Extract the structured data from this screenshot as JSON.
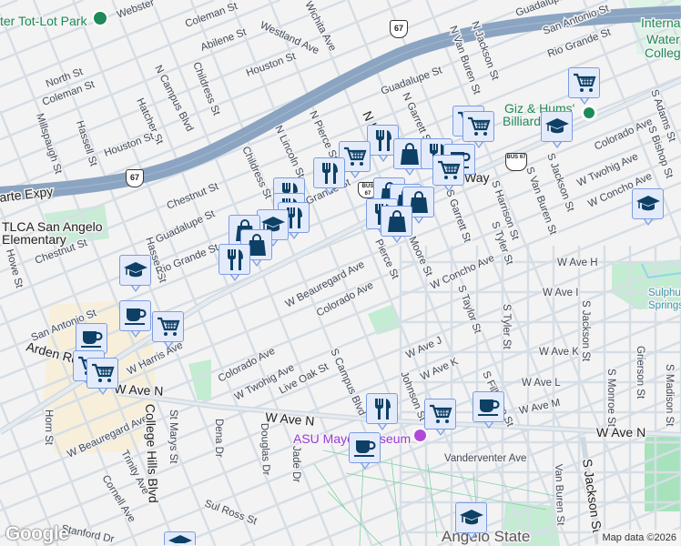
{
  "map": {
    "attribution": "Map data ©2026",
    "logo": "Google",
    "highway_shields": [
      "67",
      "67",
      "BUS 67",
      "BUS 67"
    ],
    "colors": {
      "background": "#f4f3f3",
      "road": "#d6dee6",
      "freeway": "#8ba4c1",
      "park": "#c3ecd2",
      "campus": "#f7efd9",
      "marker_fill": "#e3ebfb",
      "marker_border": "#7b9de0",
      "icon": "#0e4065"
    }
  },
  "pois": [
    {
      "name": "Giz & Hums' Billiards &",
      "icon": "place-pin-icon"
    },
    {
      "name": "ASU Mayer Museum",
      "icon": "museum-icon"
    },
    {
      "name": "ter Tot-Lot Park",
      "icon": "park-tree-icon"
    }
  ],
  "labels": [
    "ter Tot-Lot Park",
    "Webster",
    "Coleman St",
    "Abilene St",
    "Westland Ave",
    "Wichita Ave",
    "Houston St",
    "North St",
    "Coleman St",
    "Millspaugh St",
    "Hassell St",
    "Hatcher St",
    "N Campus Blvd",
    "Childress St",
    "Houston St",
    "arte Expy",
    "Chestnut St",
    "Guadalupe St",
    "N Lincoln St",
    "N Pierce St",
    "Childress St",
    "TLCA San Angelo",
    "Elementary",
    "Howe St",
    "Chestnut St",
    "Hassell St",
    "Rio Grande St",
    "Grande St",
    "San Antonio St",
    "Arden Rd",
    "W Harris Ave",
    "W Ave N",
    "W Beauregard Ave",
    "Horn St",
    "College Hills Blvd",
    "St Marys St",
    "Dena Dr",
    "Douglas Dr",
    "Jade Dr",
    "Trinity Ave",
    "Cornell Ave",
    "Sul Ross St",
    "Stanford Dr",
    "W Beauregard Ave",
    "Colorado Ave",
    "Colorado Ave",
    "W Twohig Ave",
    "Live Oak St",
    "S Campus Blvd",
    "W Ave N",
    "ASU Mayer Museum",
    "Guadalupe St",
    "N Garrett St",
    "N Van Buren St",
    "N Jackson St",
    "Guadalupe St",
    "San Antonio St",
    "Rio Grande St",
    "International",
    "Water",
    "College",
    "Giz & Hums'",
    "Billiards &",
    "Colorado Ave",
    "W Twohig Ave",
    "W Concho Ave",
    "S Adams St",
    "S Bishop St",
    "S Jackson St",
    "S Van Buren St",
    "S Harrison St",
    "S Garrett St",
    "S Tyler St",
    "Pierce St",
    "Moore St",
    "W Ave H",
    "W Concho Ave",
    "W Ave I",
    "S Taylor St",
    "S Tyler St",
    "Sulphur",
    "Springs",
    "W Ave J",
    "W Ave K",
    "W Ave K",
    "W Ave L",
    "S Fillmore St",
    "Johnson St",
    "W Ave M",
    "W Ave N",
    "Vanderventer Ave",
    "S Jackson St",
    "Van Buren St",
    "S Jackson St",
    "S Monroe St",
    "Grierson St",
    "S Madison St",
    "Angelo State",
    "N H",
    "Way"
  ],
  "markers": [
    {
      "icon": "cart"
    },
    {
      "icon": "grad"
    },
    {
      "icon": "grad"
    },
    {
      "icon": "cart"
    },
    {
      "icon": "cart"
    },
    {
      "icon": "fork"
    },
    {
      "icon": "cart"
    },
    {
      "icon": "fork"
    },
    {
      "icon": "bag"
    },
    {
      "icon": "fork"
    },
    {
      "icon": "coffee"
    },
    {
      "icon": "cart"
    },
    {
      "icon": "bag"
    },
    {
      "icon": "bag"
    },
    {
      "icon": "bag"
    },
    {
      "icon": "fork"
    },
    {
      "icon": "bag"
    },
    {
      "icon": "fork"
    },
    {
      "icon": "fork"
    },
    {
      "icon": "fork"
    },
    {
      "icon": "grad"
    },
    {
      "icon": "bag"
    },
    {
      "icon": "bag"
    },
    {
      "icon": "fork"
    },
    {
      "icon": "grad"
    },
    {
      "icon": "coffee"
    },
    {
      "icon": "cart"
    },
    {
      "icon": "coffee"
    },
    {
      "icon": "cart"
    },
    {
      "icon": "cart"
    },
    {
      "icon": "fork"
    },
    {
      "icon": "cart"
    },
    {
      "icon": "coffee"
    },
    {
      "icon": "coffee"
    },
    {
      "icon": "grad"
    },
    {
      "icon": "grad"
    }
  ]
}
